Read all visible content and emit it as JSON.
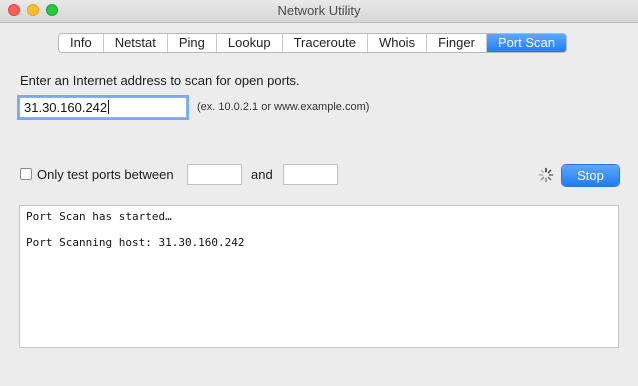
{
  "window": {
    "title": "Network Utility"
  },
  "tabs": [
    {
      "label": "Info"
    },
    {
      "label": "Netstat"
    },
    {
      "label": "Ping"
    },
    {
      "label": "Lookup"
    },
    {
      "label": "Traceroute"
    },
    {
      "label": "Whois"
    },
    {
      "label": "Finger"
    },
    {
      "label": "Port Scan",
      "active": true
    }
  ],
  "port_scan": {
    "prompt": "Enter an Internet address to scan for open ports.",
    "address_value": "31.30.160.242",
    "example_hint": "(ex. 10.0.2.1 or www.example.com)",
    "range_checkbox_label": "Only test ports between",
    "range_checked": false,
    "start_port_value": "",
    "and_label": "and",
    "end_port_value": "",
    "stop_label": "Stop",
    "output_lines": [
      "Port Scan has started…",
      "",
      "Port Scanning host: 31.30.160.242"
    ]
  },
  "colors": {
    "accent": "#1f7cf5",
    "close": "#ff5f57",
    "minimize": "#febc2e",
    "zoom": "#28c840"
  }
}
